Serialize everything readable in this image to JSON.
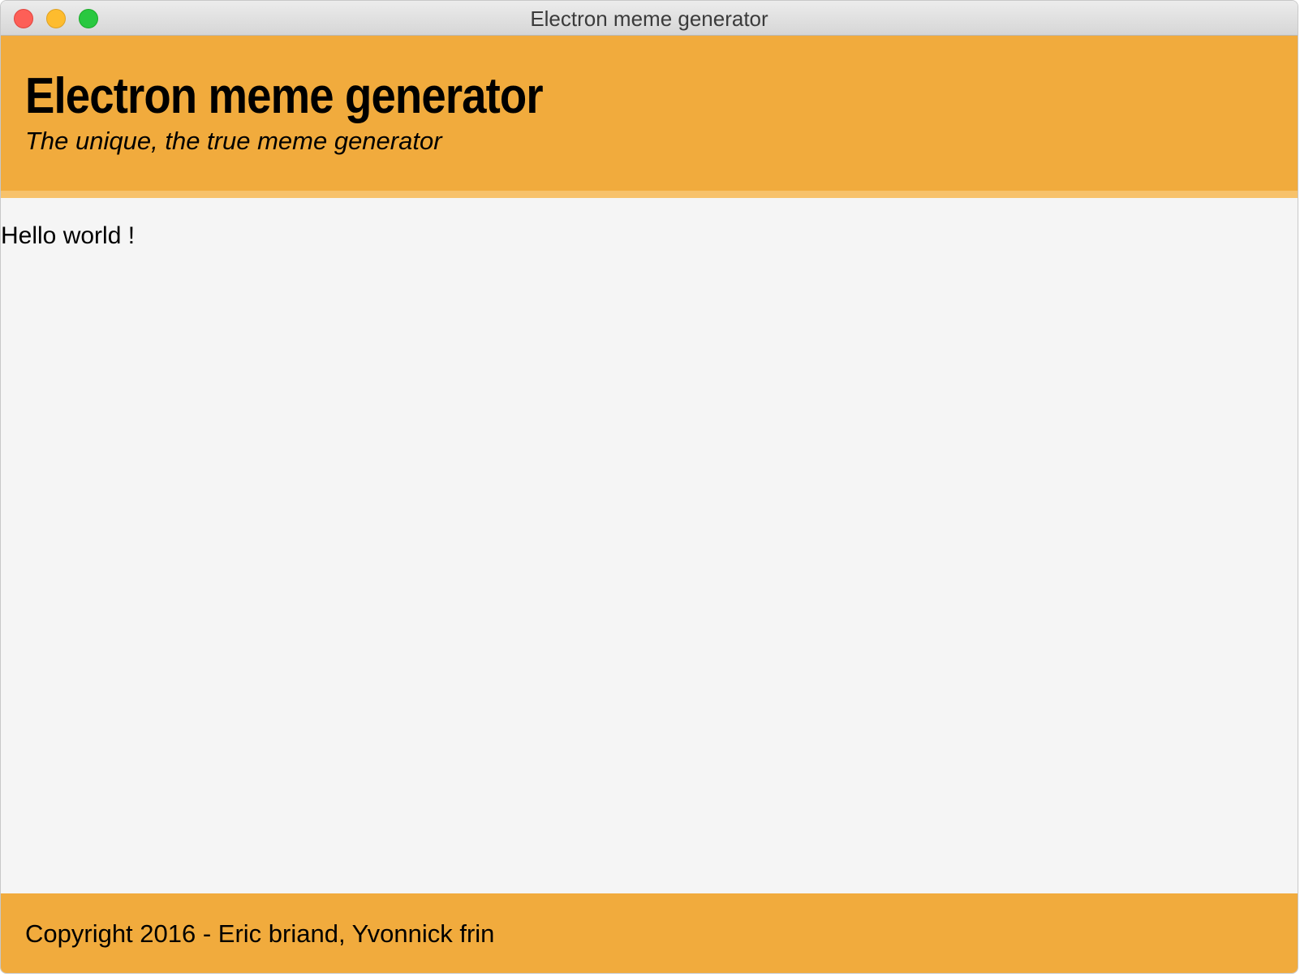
{
  "window": {
    "title": "Electron meme generator",
    "controls": {
      "close_icon": "close-icon",
      "minimize_icon": "minimize-icon",
      "maximize_icon": "maximize-icon"
    }
  },
  "header": {
    "title": "Electron meme generator",
    "subtitle": "The unique, the true meme generator"
  },
  "main": {
    "text": "Hello world !"
  },
  "footer": {
    "text": "Copyright 2016 - Eric briand, Yvonnick frin"
  },
  "colors": {
    "accent": "#f1ab3d",
    "accent_light": "#f7c26b",
    "background": "#f5f5f5",
    "close": "#fd5f57",
    "minimize": "#febc2e",
    "maximize": "#29c840"
  }
}
